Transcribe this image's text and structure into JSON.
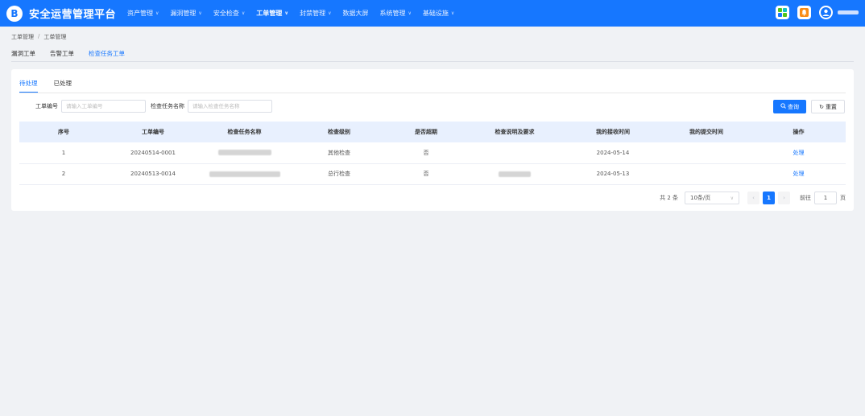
{
  "app": {
    "logo_glyph": "B",
    "title": "安全运营管理平台"
  },
  "nav": [
    {
      "label": "资产管理",
      "has_dropdown": true,
      "active": false
    },
    {
      "label": "漏洞管理",
      "has_dropdown": true,
      "active": false
    },
    {
      "label": "安全检查",
      "has_dropdown": true,
      "active": false
    },
    {
      "label": "工单管理",
      "has_dropdown": true,
      "active": true
    },
    {
      "label": "封禁管理",
      "has_dropdown": true,
      "active": false
    },
    {
      "label": "数据大屏",
      "has_dropdown": false,
      "active": false
    },
    {
      "label": "系统管理",
      "has_dropdown": true,
      "active": false
    },
    {
      "label": "基础设施",
      "has_dropdown": true,
      "active": false
    }
  ],
  "header_icons": [
    "apps-icon",
    "bell-icon",
    "avatar-icon"
  ],
  "colors": {
    "primary": "#1677ff",
    "header_bg": "#1677ff",
    "table_header_bg": "#e8f0fe"
  },
  "breadcrumb": [
    "工单管理",
    "工单管理"
  ],
  "subtabs": [
    {
      "label": "漏洞工单",
      "active": false
    },
    {
      "label": "告警工单",
      "active": false
    },
    {
      "label": "检查任务工单",
      "active": true
    }
  ],
  "inner_tabs": [
    {
      "label": "待处理",
      "active": true
    },
    {
      "label": "已处理",
      "active": false
    }
  ],
  "filters": {
    "ticket_no_label": "工单编号",
    "ticket_no_placeholder": "请输入工单编号",
    "task_name_label": "检查任务名称",
    "task_name_placeholder": "请输入检查任务名称",
    "query_label": "查询",
    "reset_label": "重置"
  },
  "table": {
    "columns": [
      "序号",
      "工单编号",
      "检查任务名称",
      "检查级别",
      "是否超期",
      "检查说明及要求",
      "我的接收时间",
      "我的提交时间",
      "操作"
    ],
    "rows": [
      {
        "index": "1",
        "ticket_no": "20240514-0001",
        "task_name": "",
        "level": "其他检查",
        "overdue": "否",
        "description": "",
        "received": "2024-05-14",
        "submitted": "",
        "action": "处理"
      },
      {
        "index": "2",
        "ticket_no": "20240513-0014",
        "task_name": "",
        "level": "总行检查",
        "overdue": "否",
        "description": "",
        "received": "2024-05-13",
        "submitted": "",
        "action": "处理"
      }
    ]
  },
  "pagination": {
    "total_text": "共 2 条",
    "page_size": "10条/页",
    "current_page": "1",
    "goto_label": "前往",
    "goto_value": "1",
    "page_suffix": "页"
  }
}
